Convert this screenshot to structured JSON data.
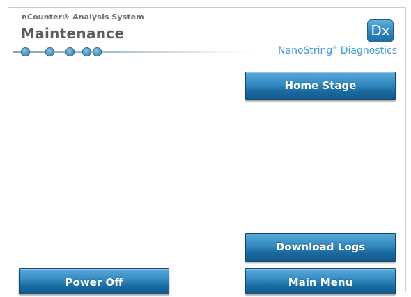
{
  "header": {
    "app_name": "nCounter® Analysis System",
    "page_title": "Maintenance",
    "logo_text": "Dx",
    "brand_name": "NanoString",
    "brand_mark": "®",
    "brand_suffix": " Diagnostics",
    "progress_steps": 5
  },
  "buttons": {
    "home_stage": "Home Stage",
    "download_logs": "Download Logs",
    "main_menu": "Main Menu",
    "power_off": "Power Off"
  },
  "colors": {
    "accent": "#2f86bd",
    "button_top": "#5aa9d8",
    "button_bottom": "#14598a",
    "brand_text": "#3f9bd2",
    "title_text": "#5d5e60"
  }
}
